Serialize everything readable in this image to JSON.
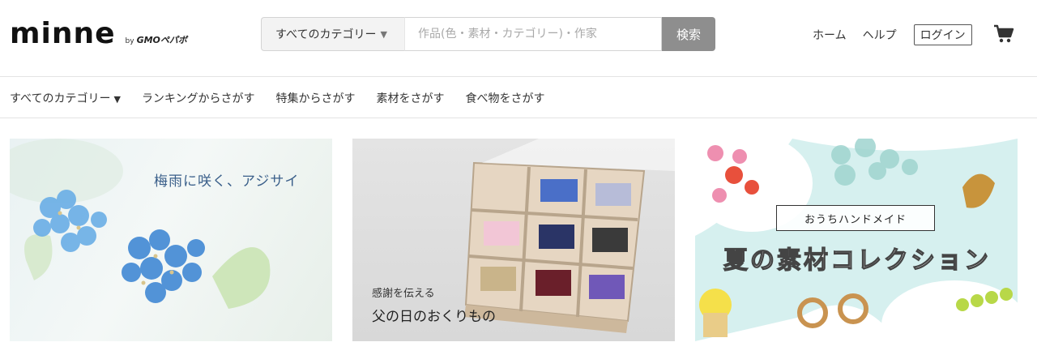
{
  "brand": {
    "logo": "minne",
    "by": "by",
    "company": "GMOペパボ"
  },
  "search": {
    "category_label": "すべてのカテゴリー",
    "placeholder": "作品(色・素材・カテゴリー)・作家",
    "button_label": "検索"
  },
  "header_nav": {
    "home": "ホーム",
    "help": "ヘルプ",
    "login": "ログイン",
    "cart_icon": "cart-icon"
  },
  "category_bar": {
    "all": "すべてのカテゴリー",
    "items": [
      "ランキングからさがす",
      "特集からさがす",
      "素材をさがす",
      "食べ物をさがす"
    ]
  },
  "banners": [
    {
      "title": "梅雨に咲く、アジサイ"
    },
    {
      "subtitle": "感謝を伝える",
      "title": "父の日のおくりもの"
    },
    {
      "tag": "おうちハンドメイド",
      "title": "夏の素材コレクション"
    }
  ],
  "colors": {
    "search_button": "#8e8e8e",
    "hydrangea": "#5aa0e0",
    "banner1_text": "#3a5f8a"
  }
}
